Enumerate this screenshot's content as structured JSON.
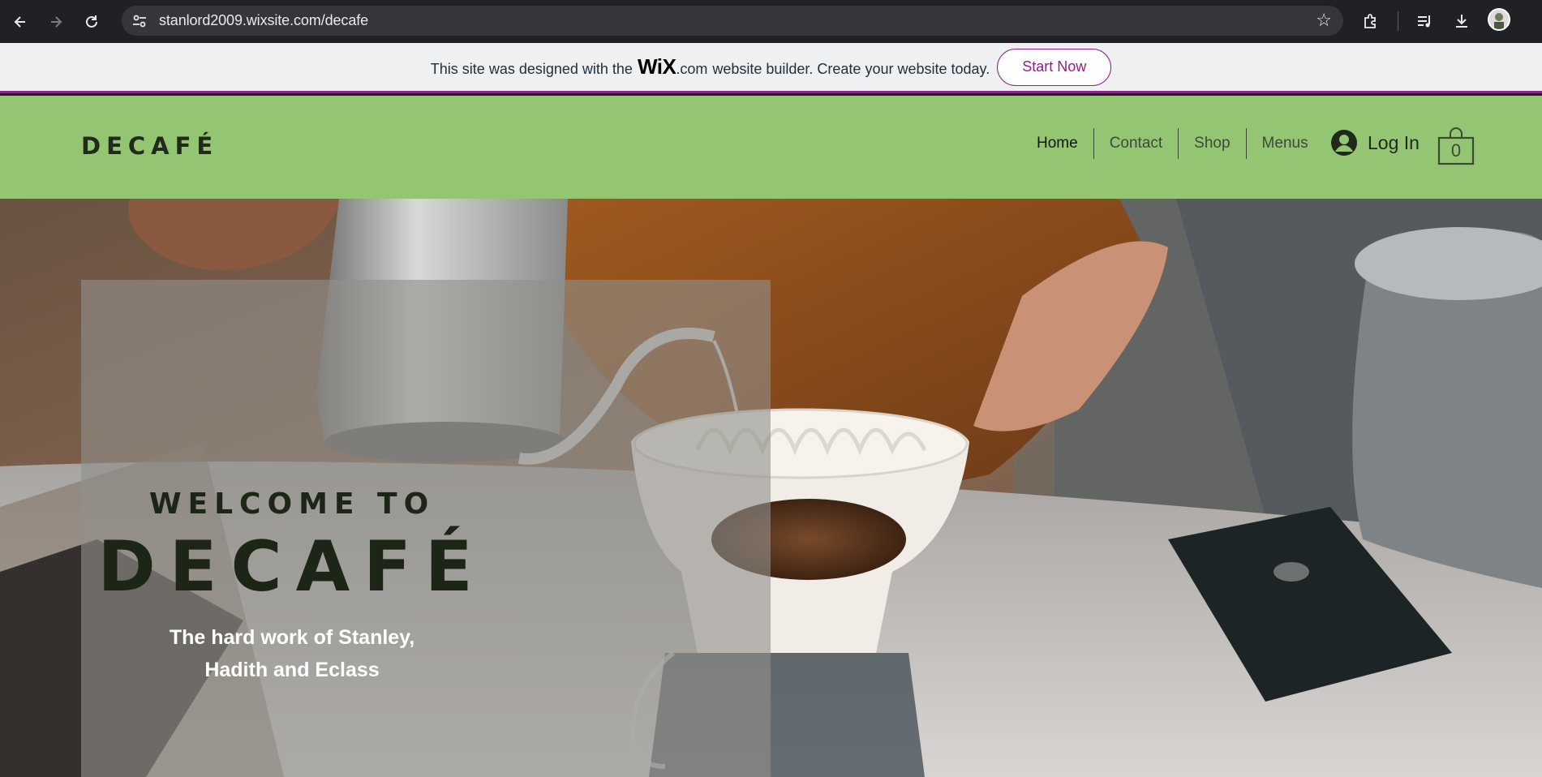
{
  "browser": {
    "url": "stanlord2009.wixsite.com/decafe",
    "icons": [
      "back-icon",
      "forward-icon",
      "reload-icon",
      "site-info-icon",
      "bookmark-star-icon",
      "extensions-icon",
      "media-icon",
      "download-icon",
      "profile-avatar"
    ]
  },
  "wix_banner": {
    "text_before": "This site was designed with the",
    "logo": "WiX",
    "logo_suffix": ".com",
    "text_after": "website builder. Create your website today.",
    "button": "Start Now"
  },
  "header": {
    "logo": "DECAFÉ",
    "nav": [
      "Home",
      "Contact",
      "Shop",
      "Menus"
    ],
    "login": "Log In",
    "cart_count": "0"
  },
  "hero": {
    "welcome": "WELCOME TO",
    "title": "DECAFÉ",
    "subtitle_line1": "The hard work of Stanley,",
    "subtitle_line2": "Hadith and Eclass"
  },
  "colors": {
    "header_bg": "#93c572",
    "wix_accent": "#8e1f8b",
    "dark_text": "#1d2616"
  }
}
